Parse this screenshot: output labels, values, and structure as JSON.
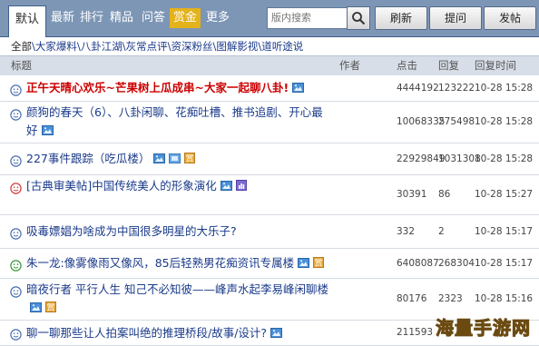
{
  "tabs": [
    {
      "label": "默认",
      "active": true
    },
    {
      "label": "最新"
    },
    {
      "label": "排行"
    },
    {
      "label": "精品"
    },
    {
      "label": "问答"
    },
    {
      "label": "赏金",
      "highlight": true
    },
    {
      "label": "更多"
    }
  ],
  "search": {
    "placeholder": "版内搜索"
  },
  "buttons": {
    "refresh": "刷新",
    "ask": "提问",
    "post": "发帖"
  },
  "category_line": {
    "first": "全部",
    "items": [
      "大家爆料",
      "八卦江湖",
      "灰常点评",
      "资深粉丝",
      "图解影视",
      "道听途说"
    ]
  },
  "table_header": {
    "title": "标题",
    "author": "作者",
    "clicks": "点击",
    "replies": "回复",
    "reply_time": "回复时间"
  },
  "rows": [
    {
      "title": "正午天晴心欢乐~芒果树上瓜成串~大家一起聊八卦!",
      "red": true,
      "icons": [
        "picture-icon"
      ],
      "clicks": "4444192",
      "replies": "123222",
      "time": "10-28 15:28"
    },
    {
      "title": "颜狗的春天（6）、八卦闲聊、花痴吐槽、推书追剧、开心最好",
      "red": false,
      "icons": [
        "picture-icon"
      ],
      "clicks": "10068335",
      "replies": "275498",
      "time": "10-28 15:28"
    },
    {
      "title": "227事件跟踪（吃瓜楼）",
      "red": false,
      "icons": [
        "picture-icon",
        "attachment-icon",
        "reward-icon"
      ],
      "clicks": "22929849",
      "replies": "1031308",
      "time": "10-28 15:28"
    },
    {
      "title": "[古典审美帖]中国传统美人的形象演化",
      "red": false,
      "icons": [
        "picture-icon",
        "chart-icon"
      ],
      "clicks": "30391",
      "replies": "86",
      "time": "10-28 15:27"
    },
    {
      "title": "吸毒嫖娼为啥成为中国很多明星的大乐子?",
      "red": false,
      "icons": [],
      "clicks": "332",
      "replies": "2",
      "time": "10-28 15:17"
    },
    {
      "title": "朱一龙:像雾像雨又像风，85后轻熟男花痴资讯专属楼",
      "red": false,
      "icons": [
        "picture-icon",
        "reward-icon"
      ],
      "clicks": "6408087",
      "replies": "268304",
      "time": "10-28 15:17"
    },
    {
      "title": "暗夜行者 平行人生 知己不必知彼——峰声水起李易峰闲聊楼",
      "red": false,
      "icons": [
        "picture-icon",
        "reward-icon"
      ],
      "clicks": "80176",
      "replies": "2323",
      "time": "10-28 15:16"
    },
    {
      "title": "聊一聊那些让人拍案叫绝的推理桥段/故事/设计?",
      "red": false,
      "icons": [
        "picture-icon"
      ],
      "clicks": "211593",
      "replies": "",
      "time": ""
    }
  ],
  "watermark": "海量手游网",
  "colors": {
    "tabbar": "#7d96b6",
    "link": "#1a3a8a",
    "sticky_title": "#cc0000",
    "reward_tab": "#e4b21a",
    "header_bg": "#d8dee8"
  }
}
